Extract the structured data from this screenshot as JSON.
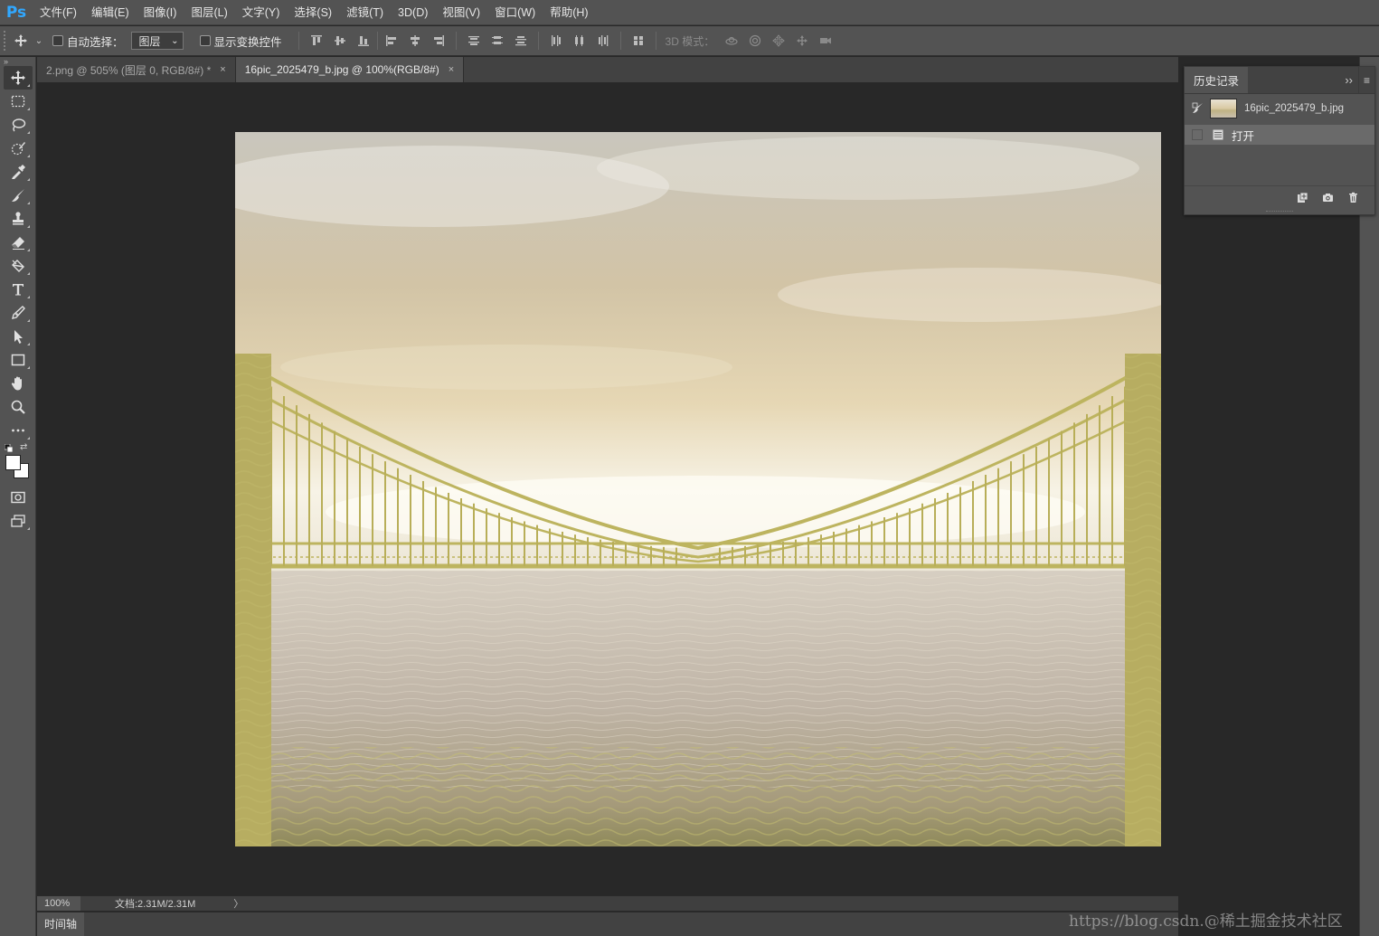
{
  "app": {
    "logo": "Ps"
  },
  "menu": [
    "文件(F)",
    "编辑(E)",
    "图像(I)",
    "图层(L)",
    "文字(Y)",
    "选择(S)",
    "滤镜(T)",
    "3D(D)",
    "视图(V)",
    "窗口(W)",
    "帮助(H)"
  ],
  "options": {
    "auto_select_label": "自动选择：",
    "auto_select_value": "图层",
    "show_transform_label": "显示变换控件",
    "mode_3d_label": "3D 模式："
  },
  "tabs": [
    {
      "label": "2.png @ 505% (图层 0, RGB/8#) *",
      "close": "×"
    },
    {
      "label": "16pic_2025479_b.jpg @ 100%(RGB/8#)",
      "close": "×"
    }
  ],
  "status": {
    "zoom": "100%",
    "doc_size": "文档:2.31M/2.31M",
    "arrow": "〉"
  },
  "timeline": {
    "label": "时间轴"
  },
  "history": {
    "title": "历史记录",
    "collapse": "››",
    "menu": "≡",
    "snapshot": "16pic_2025479_b.jpg",
    "states": [
      "打开"
    ]
  },
  "toolbar": {
    "collapse": "»",
    "swap": "⇄"
  },
  "colors": {
    "foreground": "#ffffff",
    "background": "#ffffff",
    "accent": "#31a8ff"
  },
  "watermark": "https://blog.csdn.@稀土掘金技术社区",
  "icons": [
    "move-icon",
    "marquee-icon",
    "lasso-icon",
    "quick-select-icon",
    "eyedropper-icon",
    "brush-icon",
    "stamp-icon",
    "eraser-icon",
    "paint-bucket-icon",
    "type-icon",
    "pen-icon",
    "path-select-icon",
    "rectangle-icon",
    "hand-icon",
    "zoom-icon",
    "more-icon",
    "quick-mask-icon",
    "screen-mode-icon"
  ]
}
